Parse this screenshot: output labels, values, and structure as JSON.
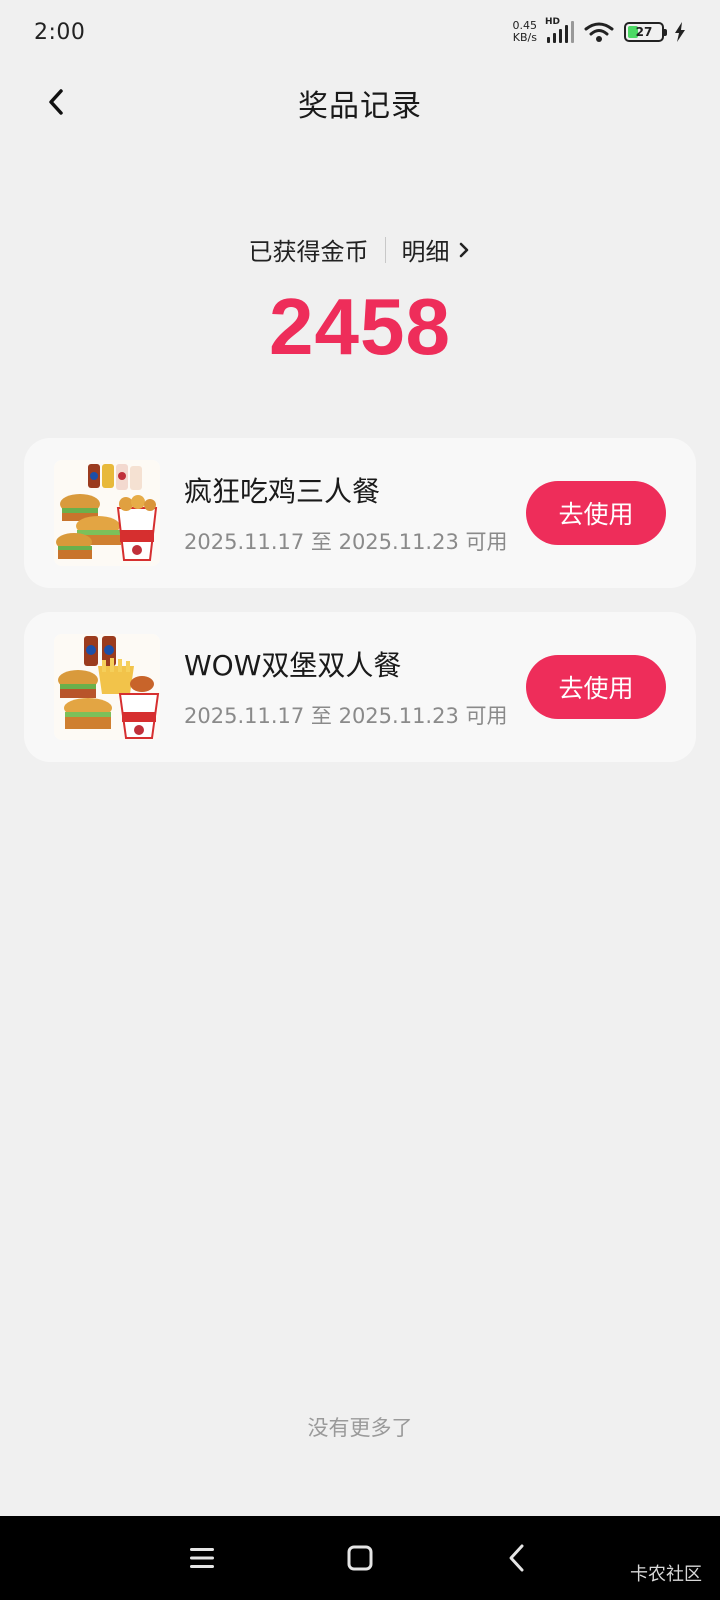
{
  "status_bar": {
    "time": "2:00",
    "net_speed_value": "0.45",
    "net_speed_unit": "KB/s",
    "network_type": "HD",
    "battery_level": "27"
  },
  "header": {
    "title": "奖品记录"
  },
  "coins": {
    "label": "已获得金币",
    "detail_label": "明细",
    "count": "2458"
  },
  "prizes": [
    {
      "name": "疯狂吃鸡三人餐",
      "validity": "2025.11.17 至 2025.11.23 可用",
      "button_label": "去使用"
    },
    {
      "name": "WOW双堡双人餐",
      "validity": "2025.11.17 至 2025.11.23 可用",
      "button_label": "去使用"
    }
  ],
  "footer": {
    "no_more_text": "没有更多了"
  },
  "nav_bar": {
    "watermark": "卡农社区"
  },
  "colors": {
    "accent": "#ee2d5a",
    "background": "#f0f0f0",
    "card": "#f8f8f8"
  }
}
